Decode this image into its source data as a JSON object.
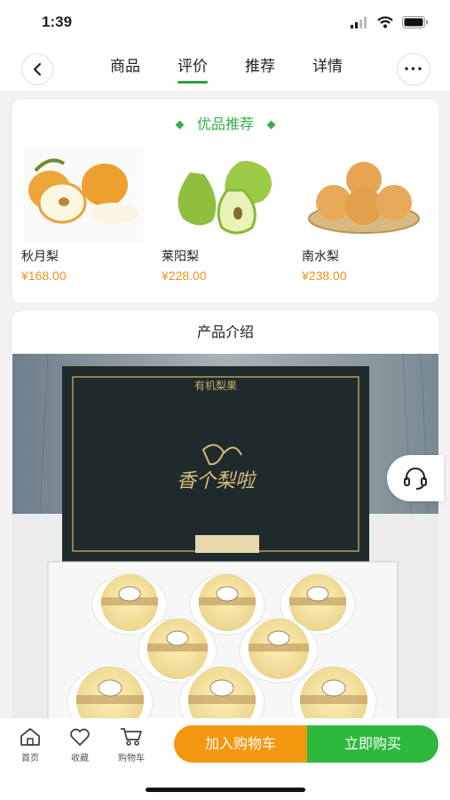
{
  "status": {
    "time": "1:39"
  },
  "nav": {
    "tabs": [
      {
        "label": "商品"
      },
      {
        "label": "评价"
      },
      {
        "label": "推荐"
      },
      {
        "label": "详情"
      }
    ],
    "more_label": "•••"
  },
  "recommend": {
    "title": "优品推荐",
    "items": [
      {
        "name": "秋月梨",
        "price": "¥168.00"
      },
      {
        "name": "莱阳梨",
        "price": "¥228.00"
      },
      {
        "name": "南水梨",
        "price": "¥238.00"
      }
    ]
  },
  "intro": {
    "title": "产品介绍",
    "box_top_text": "有机梨果",
    "box_brand": "香个梨啦"
  },
  "bottom": {
    "home_label": "首页",
    "fav_label": "收藏",
    "cart_label": "购物车",
    "add_cart_label": "加入购物车",
    "buy_label": "立即购买"
  },
  "colors": {
    "accent": "#2aa547",
    "price": "#f0941b",
    "cart_btn": "#f5960f",
    "buy_btn": "#2fb83e"
  }
}
